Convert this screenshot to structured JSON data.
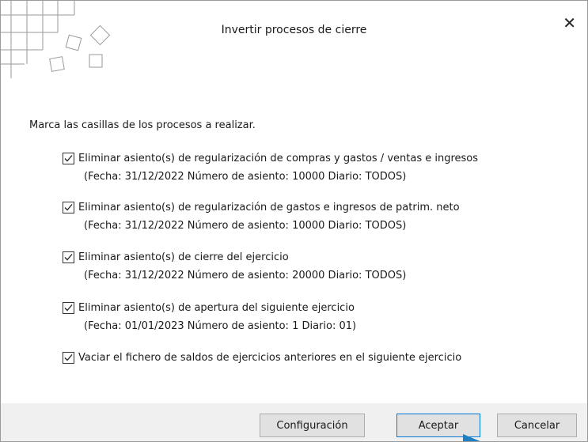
{
  "dialog": {
    "title": "Invertir procesos de cierre",
    "close_glyph": "✕",
    "instructions": "Marca las casillas de los procesos a realizar.",
    "options": [
      {
        "label": "Eliminar asiento(s) de regularización de compras y gastos / ventas e ingresos",
        "detail": "(Fecha: 31/12/2022  Número de asiento: 10000  Diario: TODOS)",
        "checked": true
      },
      {
        "label": "Eliminar asiento(s) de regularización de gastos e ingresos de patrim. neto",
        "detail": "(Fecha: 31/12/2022  Número de asiento: 10000  Diario: TODOS)",
        "checked": true
      },
      {
        "label": "Eliminar asiento(s) de cierre del ejercicio",
        "detail": "(Fecha: 31/12/2022  Número de asiento: 20000  Diario: TODOS)",
        "checked": true
      },
      {
        "label": "Eliminar asiento(s) de apertura del siguiente ejercicio",
        "detail": "(Fecha: 01/01/2023  Número de asiento: 1  Diario: 01)",
        "checked": true
      },
      {
        "label": "Vaciar el fichero de saldos de ejercicios anteriores en el siguiente ejercicio",
        "checked": true
      }
    ],
    "buttons": {
      "config": "Configuración",
      "accept": "Aceptar",
      "cancel": "Cancelar"
    }
  },
  "colors": {
    "footer_bg": "#f0f0f0",
    "button_bg": "#e1e1e1",
    "primary_border": "#0078d7",
    "cursor": "#1e7fc4"
  },
  "icons": {
    "close": "close-icon",
    "checkbox": "checkmark-icon",
    "logo": "squares-decoration-icon",
    "pointer": "mouse-pointer-icon"
  }
}
